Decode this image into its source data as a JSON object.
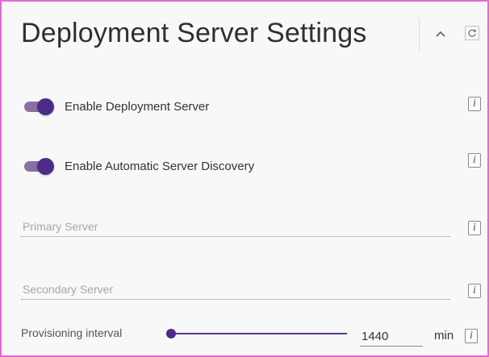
{
  "panel": {
    "title": "Deployment Server Settings",
    "collapse_icon": "chevron-up-icon",
    "refresh_icon": "refresh-icon"
  },
  "toggles": [
    {
      "label": "Enable Deployment Server",
      "enabled": true
    },
    {
      "label": "Enable Automatic Server Discovery",
      "enabled": true
    }
  ],
  "fields": {
    "primary": {
      "placeholder": "Primary Server",
      "value": ""
    },
    "secondary": {
      "placeholder": "Secondary Server",
      "value": ""
    }
  },
  "provisioning": {
    "label": "Provisioning interval",
    "value": "1440",
    "unit": "min",
    "slider_level": 0.0
  },
  "info_glyph": "i",
  "colors": {
    "accent": "#4d2b86",
    "track": "#8a6fa4",
    "border": "#e56ad2"
  }
}
